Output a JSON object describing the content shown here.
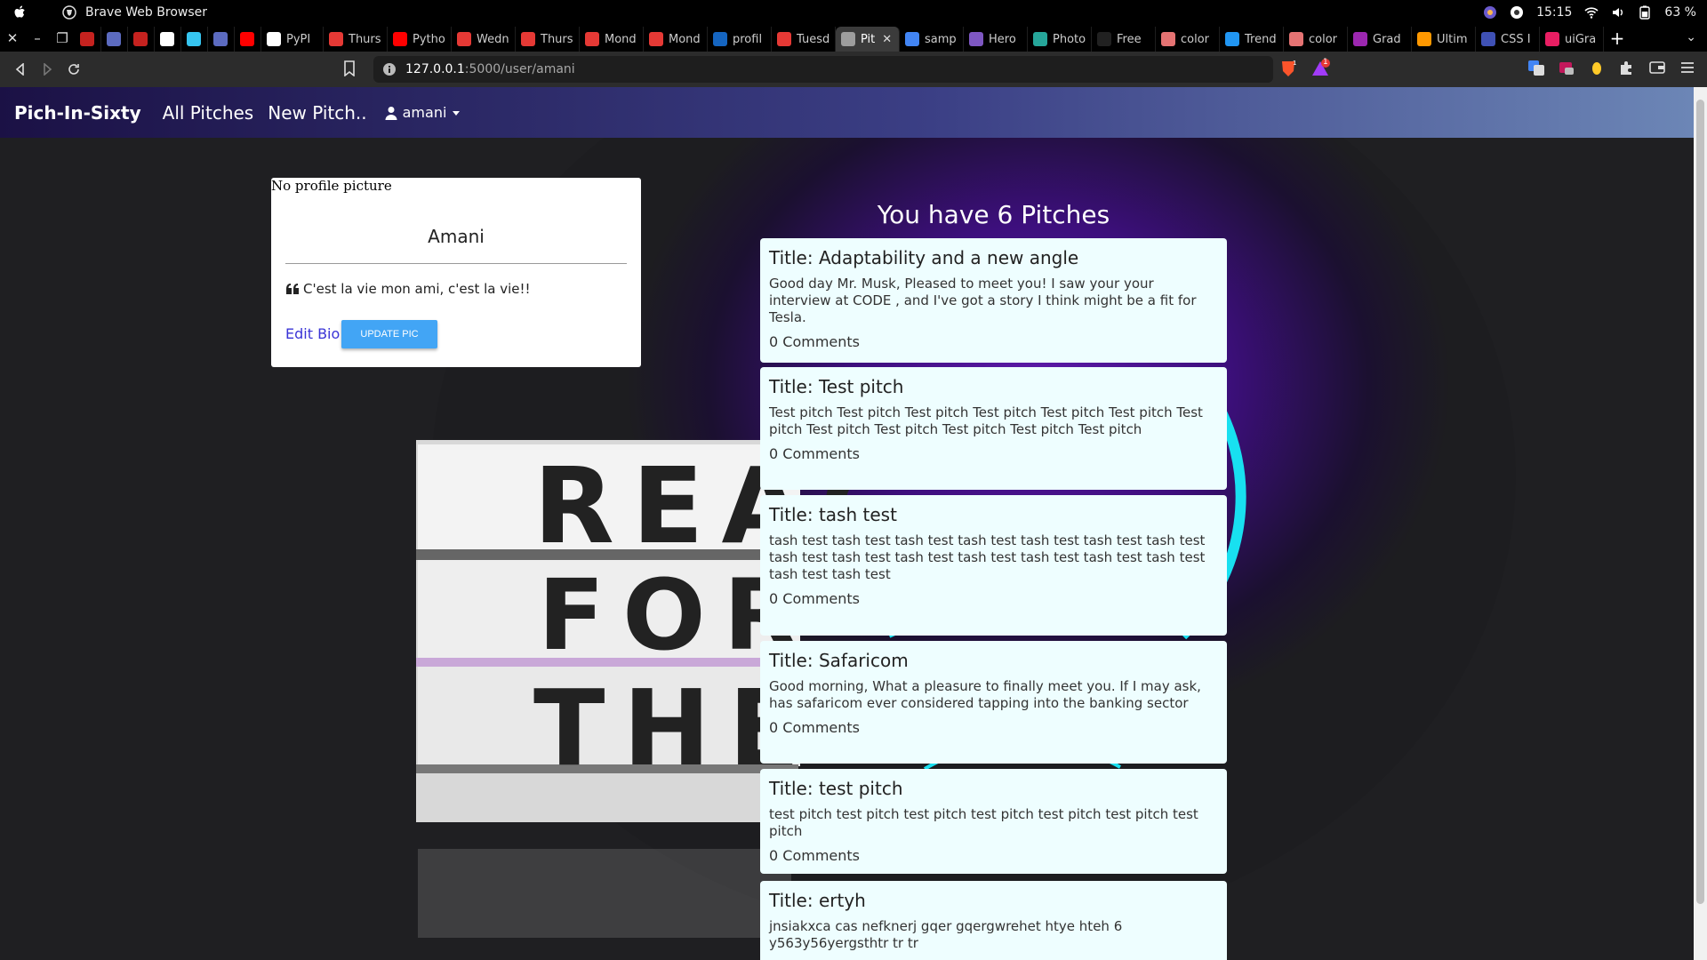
{
  "os": {
    "app_title": "Brave Web Browser",
    "clock": "15:15",
    "battery": "63 %"
  },
  "tabs": [
    {
      "label": "",
      "color": "#c5221f"
    },
    {
      "label": "",
      "color": "#5c6bc0"
    },
    {
      "label": "",
      "color": "#c5221f"
    },
    {
      "label": "",
      "color": "#ffffff"
    },
    {
      "label": "",
      "color": "#36c5f0"
    },
    {
      "label": "",
      "color": "#5c6bc0"
    },
    {
      "label": "",
      "color": "#ff0000"
    },
    {
      "label": "PyPI",
      "color": "#ffffff"
    },
    {
      "label": "Thurs",
      "color": "#e53935"
    },
    {
      "label": "Pytho",
      "color": "#ff0000"
    },
    {
      "label": "Wedn",
      "color": "#e53935"
    },
    {
      "label": "Thurs",
      "color": "#e53935"
    },
    {
      "label": "Mond",
      "color": "#e53935"
    },
    {
      "label": "Mond",
      "color": "#e53935"
    },
    {
      "label": "profil",
      "color": "#1565c0"
    },
    {
      "label": "Tuesd",
      "color": "#e53935"
    },
    {
      "label": "Pit",
      "color": "#9e9e9e",
      "active": true
    },
    {
      "label": "samp",
      "color": "#4285f4"
    },
    {
      "label": "Hero",
      "color": "#7e57c2"
    },
    {
      "label": "Photo",
      "color": "#26a69a"
    },
    {
      "label": "Free",
      "color": "#212121"
    },
    {
      "label": "color",
      "color": "#e57373"
    },
    {
      "label": "Trend",
      "color": "#2196f3"
    },
    {
      "label": "color",
      "color": "#e57373"
    },
    {
      "label": "Grad",
      "color": "#9c27b0"
    },
    {
      "label": "Ultim",
      "color": "#ff9800"
    },
    {
      "label": "CSS I",
      "color": "#3f51b5"
    },
    {
      "label": "uiGra",
      "color": "#e91e63"
    }
  ],
  "address": {
    "host": "127.0.0.1",
    "path": ":5000/user/amani",
    "rewards_badge": "1"
  },
  "site": {
    "brand": "Pich-In-Sixty",
    "nav_all": "All Pitches",
    "nav_new": "New Pitch..",
    "user": "amani"
  },
  "profile": {
    "no_picture": "No profile picture",
    "name": "Amani",
    "bio": "C'est la vie mon ami, c'est la vie!!",
    "edit_bio": "Edit Bio",
    "update_pic": "UPDATE PIC"
  },
  "pitch_count": "You have 6 Pitches",
  "pitches": [
    {
      "title": "Title: Adaptability and a new angle",
      "body": "Good day Mr. Musk, Pleased to meet you! I saw your your interview at CODE , and I've got a story I think might be a fit for Tesla.",
      "comments": "0 Comments"
    },
    {
      "title": "Title: Test pitch",
      "body": "Test pitch Test pitch Test pitch Test pitch Test pitch Test pitch Test pitch Test pitch Test pitch Test pitch Test pitch Test pitch",
      "comments": "0 Comments"
    },
    {
      "title": "Title: tash test",
      "body": "tash test tash test tash test tash test tash test tash test tash test tash test tash test tash test tash test tash test tash test tash test tash test tash test",
      "comments": "0 Comments"
    },
    {
      "title": "Title: Safaricom",
      "body": "Good morning, What a pleasure to finally meet you. If I may ask, has safaricom ever considered tapping into the banking sector",
      "comments": "0 Comments"
    },
    {
      "title": "Title: test pitch",
      "body": "test pitch test pitch test pitch test pitch test pitch test pitch test pitch",
      "comments": "0 Comments"
    },
    {
      "title": "Title: ertyh",
      "body": "jnsiakxca cas nefknerj gqer gqergwrehet htye hteh 6 y563y56yergsthtr tr tr",
      "comments": ""
    }
  ],
  "lightbox": {
    "line1": "REAC",
    "line2": "FOR",
    "line3": "THE"
  }
}
